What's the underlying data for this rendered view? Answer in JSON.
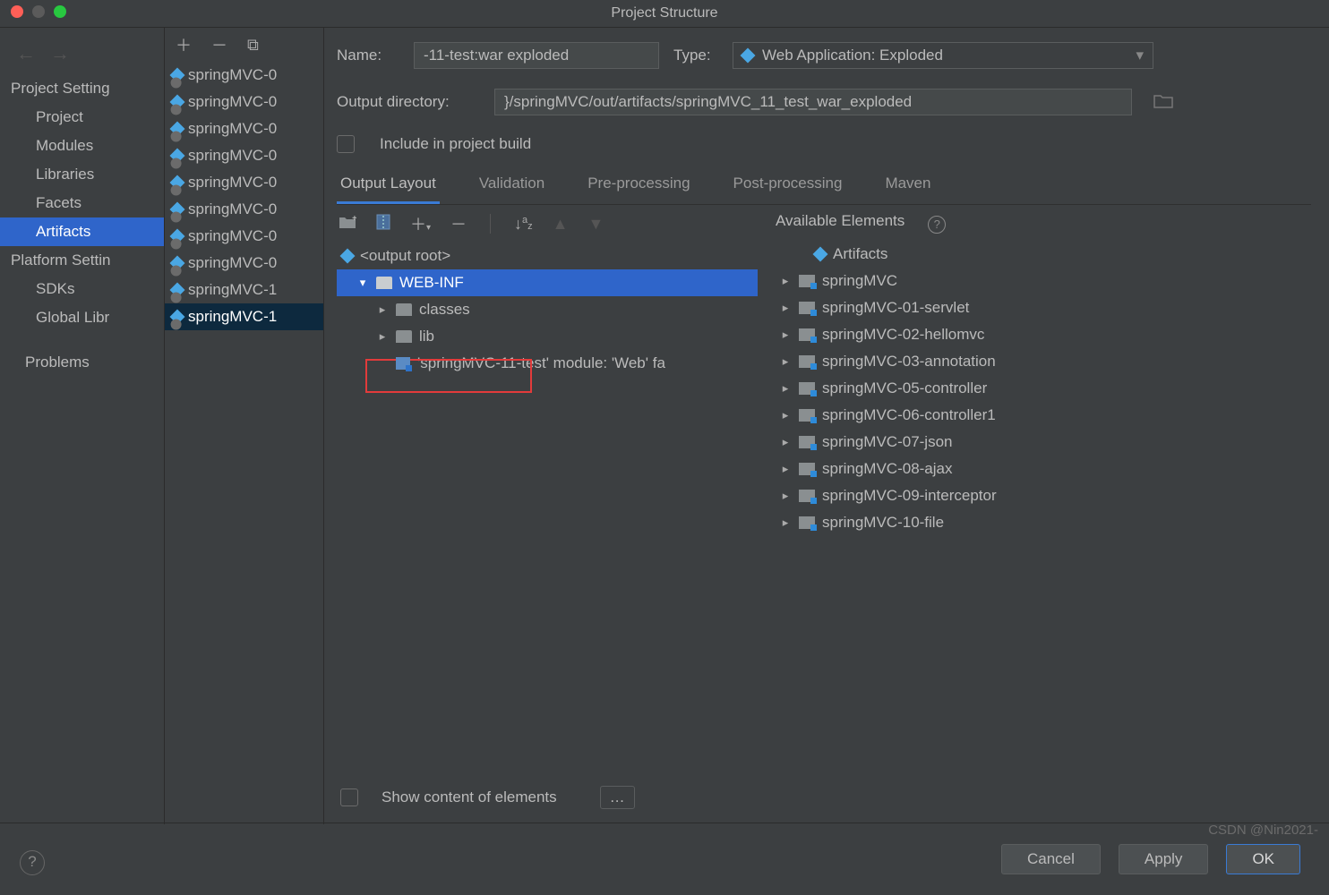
{
  "title": "Project Structure",
  "left": {
    "section1": "Project Setting",
    "items1": [
      "Project",
      "Modules",
      "Libraries",
      "Facets",
      "Artifacts"
    ],
    "section2": "Platform Settin",
    "items2": [
      "SDKs",
      "Global Libr"
    ],
    "problems": "Problems"
  },
  "artifacts": {
    "items": [
      "springMVC-0",
      "springMVC-0",
      "springMVC-0",
      "springMVC-0",
      "springMVC-0",
      "springMVC-0",
      "springMVC-0",
      "springMVC-0",
      "springMVC-1",
      "springMVC-1"
    ]
  },
  "form": {
    "name_label": "Name:",
    "name_value": "-11-test:war exploded",
    "type_label": "Type:",
    "type_value": "Web Application: Exploded",
    "outdir_label": "Output directory:",
    "outdir_value": "}/springMVC/out/artifacts/springMVC_11_test_war_exploded",
    "include_label": "Include in project build"
  },
  "tabs": [
    "Output Layout",
    "Validation",
    "Pre-processing",
    "Post-processing",
    "Maven"
  ],
  "tree": {
    "root": "<output root>",
    "webinf": "WEB-INF",
    "classes": "classes",
    "lib": "lib",
    "module_row": "'springMVC-11-test' module: 'Web' fa"
  },
  "avail": {
    "title": "Available Elements",
    "items": [
      "Artifacts",
      "springMVC",
      "springMVC-01-servlet",
      "springMVC-02-hellomvc",
      "springMVC-03-annotation",
      "springMVC-05-controller",
      "springMVC-06-controller1",
      "springMVC-07-json",
      "springMVC-08-ajax",
      "springMVC-09-interceptor",
      "springMVC-10-file"
    ]
  },
  "show_content": "Show content of elements",
  "buttons": {
    "cancel": "Cancel",
    "apply": "Apply",
    "ok": "OK"
  },
  "watermark": "CSDN @Nin2021-"
}
